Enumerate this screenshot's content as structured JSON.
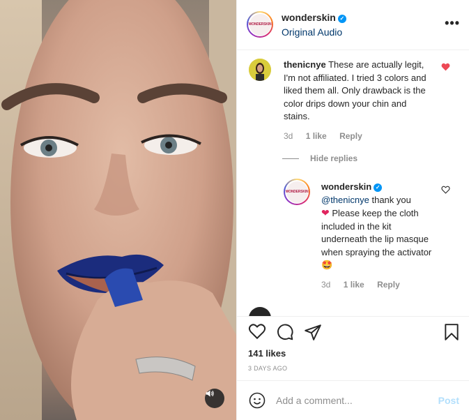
{
  "header": {
    "username": "wonderskin",
    "subtitle": "Original Audio",
    "logo_text": "WONDERSKIN",
    "more_label": "•••"
  },
  "comments": [
    {
      "username": "thenicnye",
      "text": "These are actually legit, I'm not affiliated. I tried 3 colors and liked them all. Only drawback is the color drips down your chin and stains.",
      "age": "3d",
      "likes": "1 like",
      "reply_label": "Reply",
      "liked": true
    }
  ],
  "hide_replies_label": "Hide replies",
  "reply": {
    "username": "wonderskin",
    "mention": "@thenicnye",
    "text_a": " thank you ",
    "text_b": " Please keep the cloth included in the kit underneath the lip masque when spraying the activator",
    "emoji_heart": "❤",
    "emoji_star": "🤩",
    "age": "3d",
    "likes": "1 like",
    "reply_label": "Reply"
  },
  "actions": {
    "likes": "141 likes",
    "date": "3 DAYS AGO"
  },
  "composer": {
    "placeholder": "Add a comment...",
    "post_label": "Post"
  },
  "colors": {
    "verified": "#0095f6",
    "link": "#00376b",
    "meta": "#8e8e8e",
    "liked_heart": "#ed4956",
    "post_disabled": "#b2dffc"
  },
  "icons": [
    "verified-badge-icon",
    "more-icon",
    "heart-icon",
    "comment-icon",
    "share-icon",
    "save-icon",
    "emoji-icon",
    "volume-icon"
  ]
}
